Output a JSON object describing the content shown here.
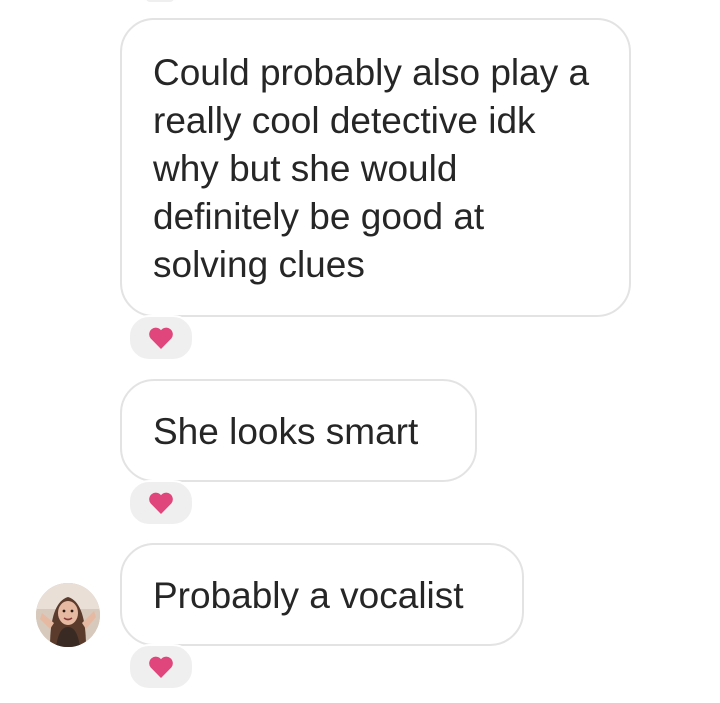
{
  "thread": {
    "messages": [
      {
        "text": "Could probably also play a really cool detective idk why but she would definitely be good at solving clues",
        "reaction": "heart"
      },
      {
        "text": "She looks smart",
        "reaction": "heart"
      },
      {
        "text": "Probably a vocalist",
        "reaction": "heart",
        "has_avatar": true
      }
    ]
  },
  "colors": {
    "heart": "#e0457b",
    "bubble_border": "#e3e3e3",
    "reaction_bg": "#efefef",
    "text": "#262626"
  }
}
